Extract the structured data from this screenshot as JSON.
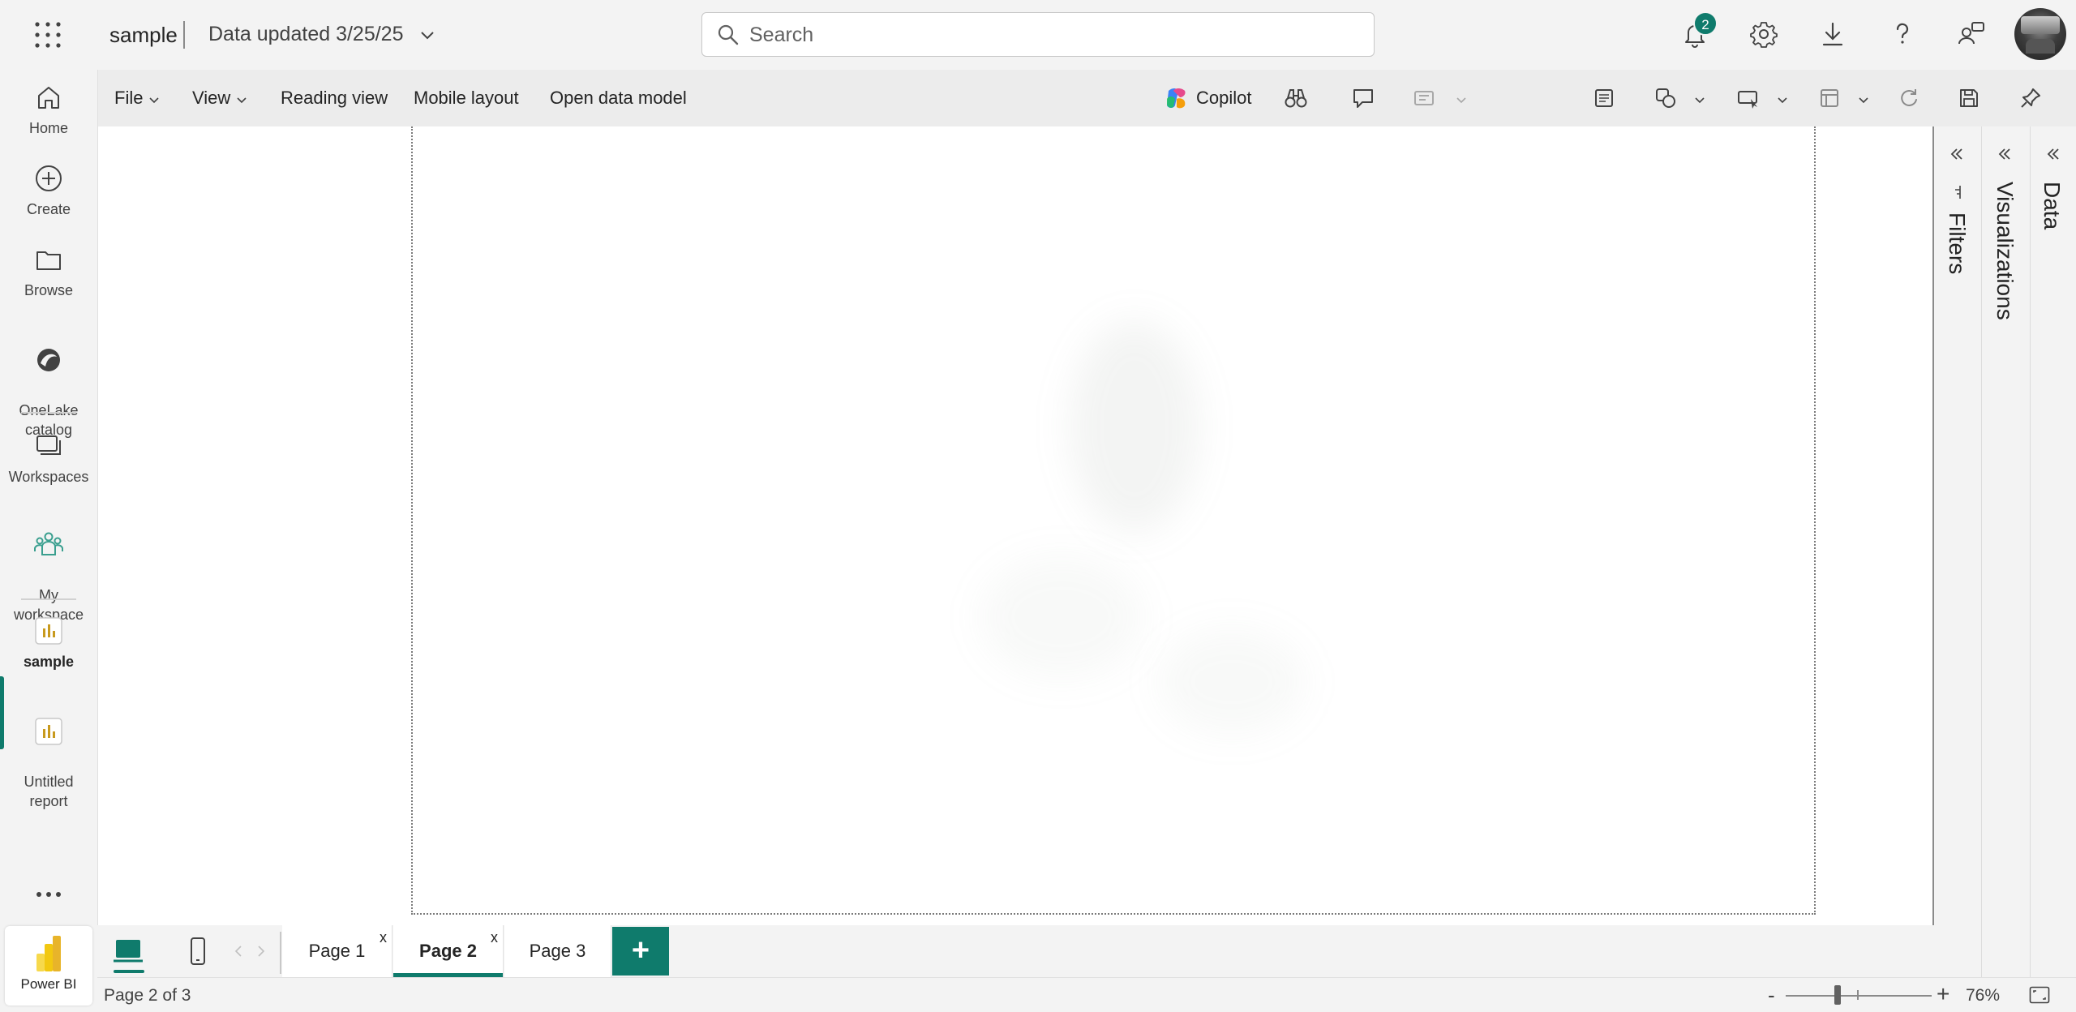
{
  "header": {
    "app_name": "sample",
    "data_updated": "Data updated 3/25/25",
    "search_placeholder": "Search",
    "notification_count": "2"
  },
  "leftnav": {
    "items": [
      {
        "label": "Home",
        "icon": "home-icon"
      },
      {
        "label": "Create",
        "icon": "plus-circle-icon"
      },
      {
        "label": "Browse",
        "icon": "folder-icon"
      },
      {
        "label": "OneLake\ncatalog",
        "icon": "onelake-icon"
      },
      {
        "label": "Workspaces",
        "icon": "workspaces-icon"
      },
      {
        "label": "My\nworkspace",
        "icon": "people-icon"
      },
      {
        "label": "sample",
        "icon": "report-icon",
        "active": true
      },
      {
        "label": "Untitled\nreport",
        "icon": "report-icon"
      }
    ],
    "product": "Power BI"
  },
  "ribbon": {
    "file": "File",
    "view": "View",
    "reading_view": "Reading view",
    "mobile_layout": "Mobile layout",
    "open_data_model": "Open data model",
    "copilot": "Copilot"
  },
  "panes": {
    "filters": "Filters",
    "visualizations": "Visualizations",
    "data": "Data"
  },
  "pages": {
    "tabs": [
      {
        "label": "Page 1",
        "close": "x",
        "active": false
      },
      {
        "label": "Page 2",
        "close": "x",
        "active": true
      },
      {
        "label": "Page 3",
        "active": false
      }
    ],
    "add_label": "+"
  },
  "status": {
    "page_status": "Page 2 of 3",
    "zoom_minus": "-",
    "zoom_plus": "+",
    "zoom_level": "76%"
  },
  "colors": {
    "accent": "#0f7b6c",
    "background": "#f3f3f3",
    "canvas": "#ffffff"
  }
}
